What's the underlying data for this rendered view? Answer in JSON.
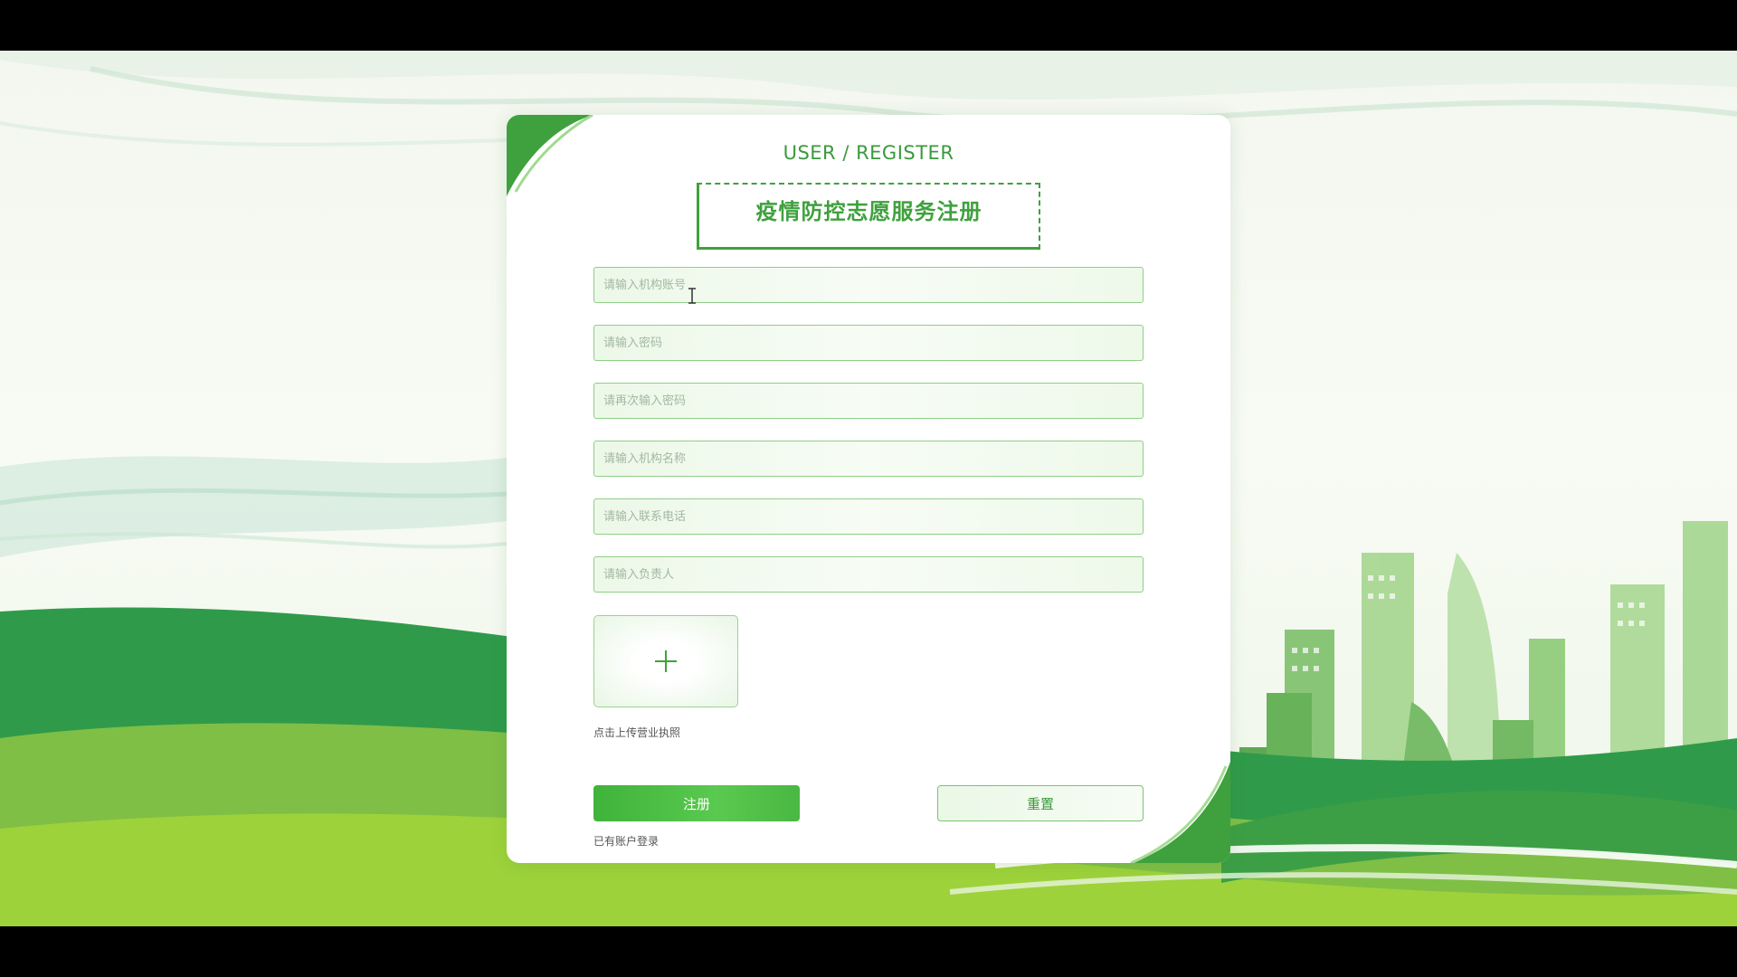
{
  "header": {
    "subtitle": "USER / REGISTER",
    "title": "疫情防控志愿服务注册"
  },
  "form": {
    "account_placeholder": "请输入机构账号",
    "password_placeholder": "请输入密码",
    "password_confirm_placeholder": "请再次输入密码",
    "org_name_placeholder": "请输入机构名称",
    "phone_placeholder": "请输入联系电话",
    "manager_placeholder": "请输入负责人",
    "upload_hint": "点击上传营业执照"
  },
  "actions": {
    "register_label": "注册",
    "reset_label": "重置",
    "login_link": "已有账户登录"
  },
  "colors": {
    "accent": "#3fa13d",
    "field_border": "#8fcf86",
    "page_background": "#f3f7ef"
  },
  "icons": {
    "upload": "plus-icon",
    "cursor": "text-cursor-icon"
  }
}
